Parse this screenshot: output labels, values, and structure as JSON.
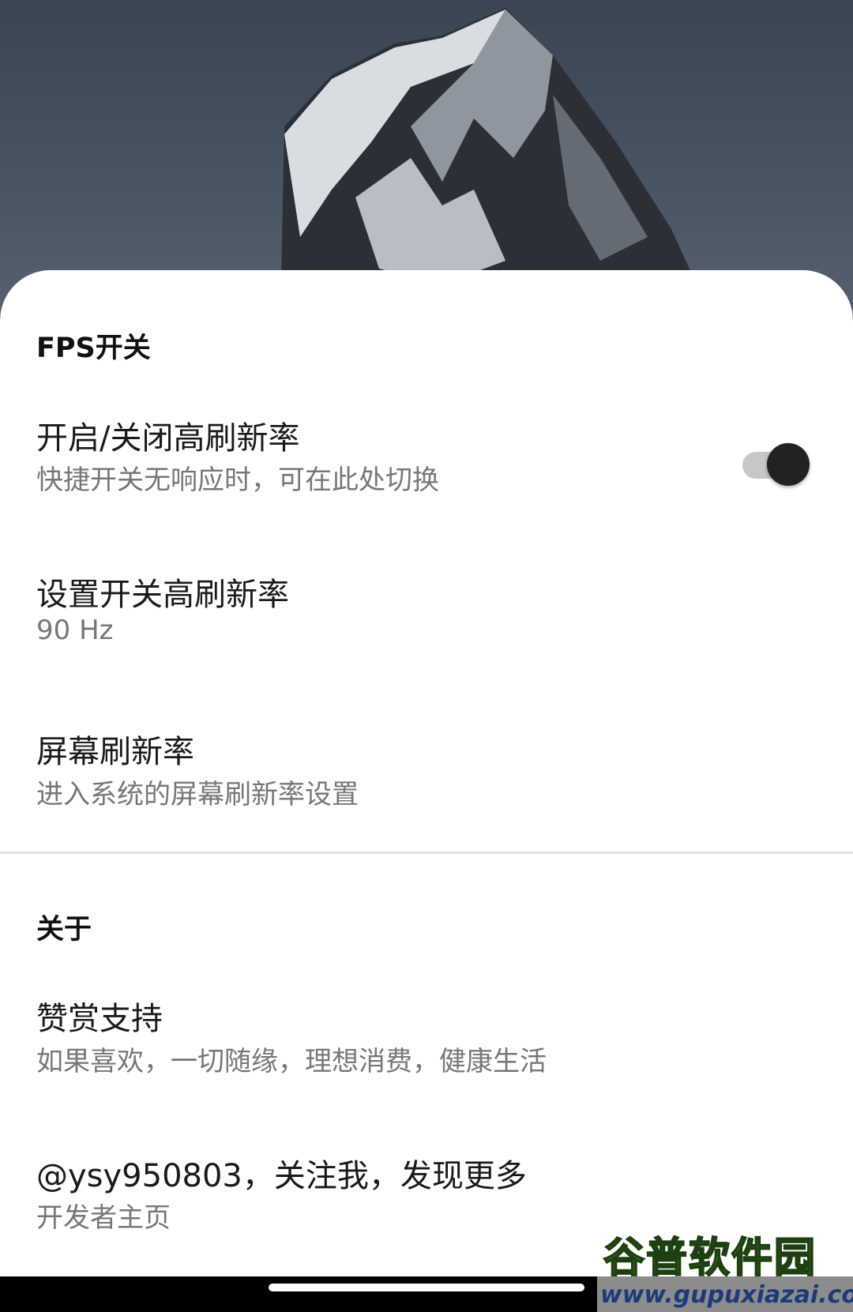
{
  "sections": {
    "fps": {
      "title": "FPS开关",
      "items": [
        {
          "title": "开启/关闭高刷新率",
          "summary": "快捷开关无响应时，可在此处切换",
          "toggle_on": true
        },
        {
          "title": "设置开关高刷新率",
          "summary": "90 Hz"
        },
        {
          "title": "屏幕刷新率",
          "summary": "进入系统的屏幕刷新率设置"
        }
      ]
    },
    "about": {
      "title": "关于",
      "items": [
        {
          "title": "赞赏支持",
          "summary": "如果喜欢，一切随缘，理想消费，健康生活"
        },
        {
          "title": "@ysy950803，关注我，发现更多",
          "summary": "开发者主页"
        }
      ]
    }
  },
  "watermark": {
    "title": "谷普软件园",
    "url": "www.gupuxiazai.com"
  },
  "colors": {
    "accent_thumb": "#222222",
    "track": "#c7c7c7",
    "sheet_bg": "#ffffff",
    "summary_text": "#777777"
  }
}
